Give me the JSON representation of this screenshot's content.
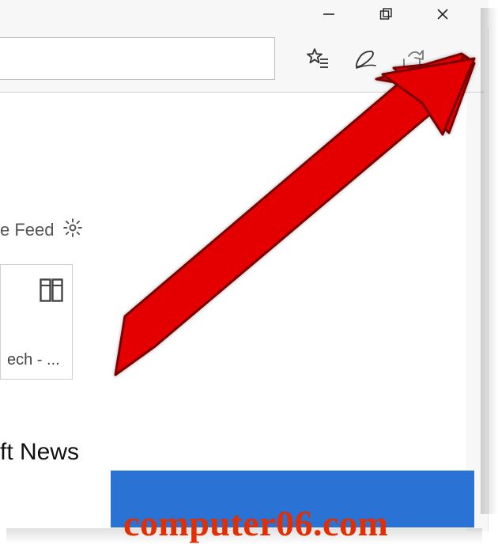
{
  "window": {
    "minimize_name": "minimize",
    "maximize_name": "maximize",
    "close_name": "close"
  },
  "toolbar": {
    "address_value": "",
    "favorites_name": "favorites-icon",
    "notes_name": "web-notes-icon",
    "share_name": "share-icon",
    "more_name": "more-icon"
  },
  "content": {
    "feed_label": "e Feed",
    "tile_label": "ech - ...",
    "news_heading": "ft News"
  },
  "watermark": {
    "text": "computer06.com"
  },
  "colors": {
    "stripe": "#2a72d4",
    "arrow": "#e40000",
    "watermark": "#e22e00"
  }
}
